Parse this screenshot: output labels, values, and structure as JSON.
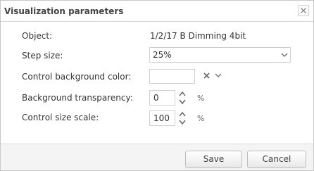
{
  "dialog": {
    "title": "Visualization parameters"
  },
  "fields": {
    "object": {
      "label": "Object:",
      "value": "1/2/17 B Dimming 4bit"
    },
    "step_size": {
      "label": "Step size:",
      "value": "25%"
    },
    "bg_color": {
      "label": "Control background color:",
      "value": ""
    },
    "bg_transparency": {
      "label": "Background transparency:",
      "value": "0",
      "unit": "%"
    },
    "size_scale": {
      "label": "Control size scale:",
      "value": "100",
      "unit": "%"
    }
  },
  "buttons": {
    "save": "Save",
    "cancel": "Cancel"
  },
  "icons": {
    "close": "close-icon",
    "dropdown": "chevron-down-icon",
    "clear": "clear-x-icon",
    "spinner": "spinner-icon"
  },
  "colors": {
    "border": "#c8c8c8",
    "footer_bg": "#f4f4f4",
    "text": "#333333"
  }
}
